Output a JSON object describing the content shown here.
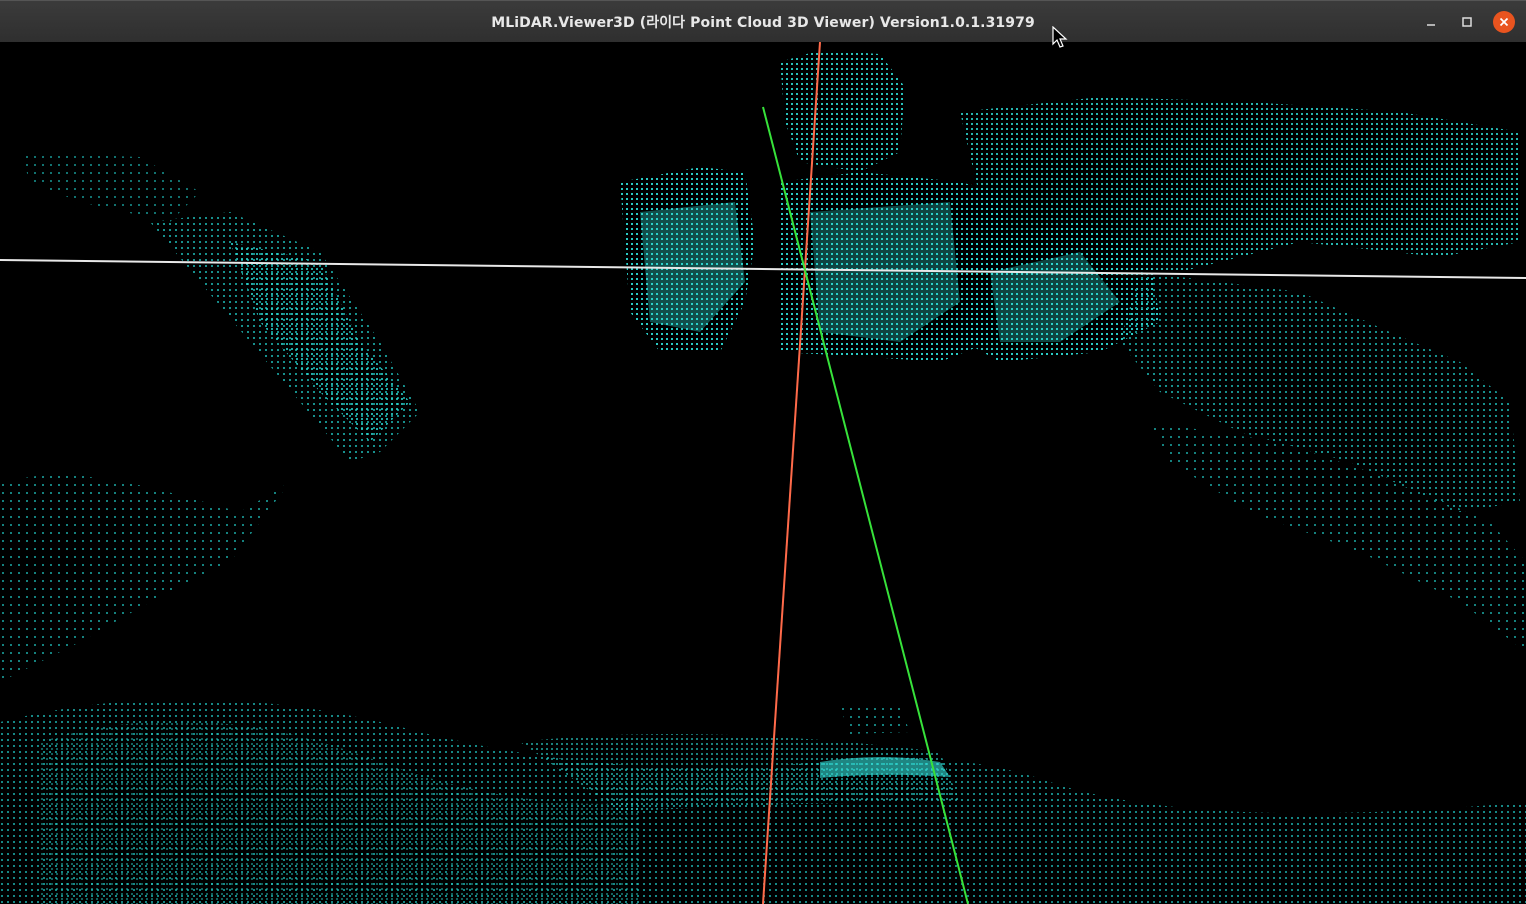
{
  "window": {
    "title": "MLiDAR.Viewer3D (라이다 Point Cloud 3D Viewer) Version1.0.1.31979"
  },
  "controls": {
    "minimize_icon": "minimize-icon",
    "maximize_icon": "maximize-icon",
    "close_icon": "close-icon"
  },
  "colors": {
    "points": "#2bd6cf",
    "points_dim": "#138a88",
    "axis_x": "#ff6a4a",
    "axis_y": "#37e23a",
    "axis_z": "#e8e8e8",
    "titlebar": "#333333",
    "close": "#e9541f"
  }
}
